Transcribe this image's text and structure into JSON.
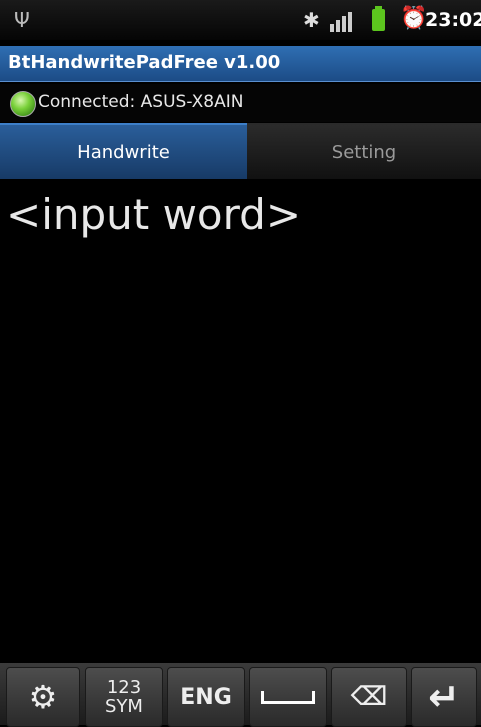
{
  "status_bar": {
    "usb_icon": "usb-icon",
    "bluetooth_icon": "bluetooth-icon",
    "signal_icon": "signal-icon",
    "battery_icon": "battery-icon",
    "alarm_icon": "alarm-icon",
    "time": "23:02"
  },
  "app": {
    "title": "BtHandwritePadFree v1.00"
  },
  "connection": {
    "status_icon": "connected-led-icon",
    "text": "Connected: ASUS-X8AIN",
    "color": "#7ad13a"
  },
  "tabs": [
    {
      "label": "Handwrite",
      "active": true
    },
    {
      "label": "Setting",
      "active": false
    }
  ],
  "input": {
    "placeholder": "<input word>"
  },
  "keyboard": {
    "settings_icon": "gear-icon",
    "sym_line1": "123",
    "sym_line2": "SYM",
    "lang": "ENG",
    "space_icon": "space-icon",
    "backspace_icon": "backspace-icon",
    "enter_icon": "enter-icon"
  },
  "colors": {
    "title_bar": "#2f6fb3",
    "active_tab": "#2a5e9a",
    "background": "#000000"
  }
}
